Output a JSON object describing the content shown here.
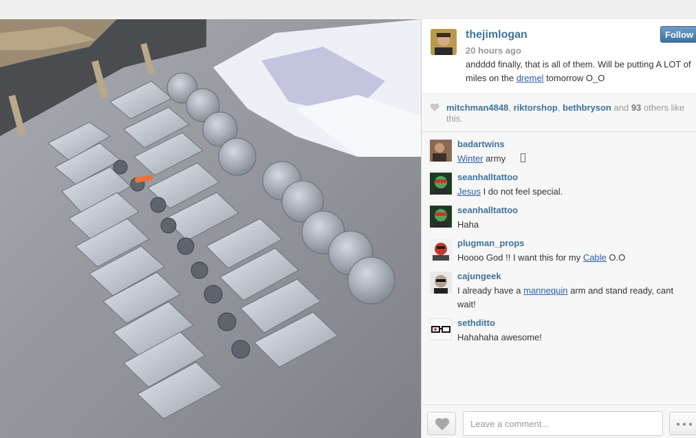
{
  "post": {
    "username": "thejimlogan",
    "time_ago": "20 hours ago",
    "follow_label": "Follow",
    "caption": {
      "before_link": "andddd finally, that is all of them. Will be putting A LOT of miles on the ",
      "link": "dremel",
      "after_link": " tomorrow O_O"
    },
    "photo_alt": "armor-pieces-photo"
  },
  "likes": {
    "users": [
      "mitchman4848",
      "riktorshop",
      "bethbryson"
    ],
    "sep1": ", ",
    "sep2": ", ",
    "and_text": " and ",
    "others_count": "93",
    "suffix": " others like this."
  },
  "comments": [
    {
      "user": "badartwins",
      "link": "Winter",
      "text": " army"
    },
    {
      "user": "seanhalltattoo",
      "link": "Jesus",
      "text": " I do not feel special."
    },
    {
      "user": "seanhalltattoo",
      "text": "Haha"
    },
    {
      "user": "plugman_props",
      "before": "Hoooo God !! I want this for my ",
      "link": "Cable",
      "text": " O.O"
    },
    {
      "user": "cajungeek",
      "before": "I already have a ",
      "link": "mannequin",
      "text": " arm and stand ready, cant wait!"
    },
    {
      "user": "sethditto",
      "text": "Hahahaha awesome!"
    }
  ],
  "footer": {
    "comment_placeholder": "Leave a comment...",
    "like_icon": "heart-icon",
    "more_icon": "ellipsis-icon"
  },
  "colors": {
    "link_blue": "#3f729b",
    "follow_button": "#3f729b"
  }
}
